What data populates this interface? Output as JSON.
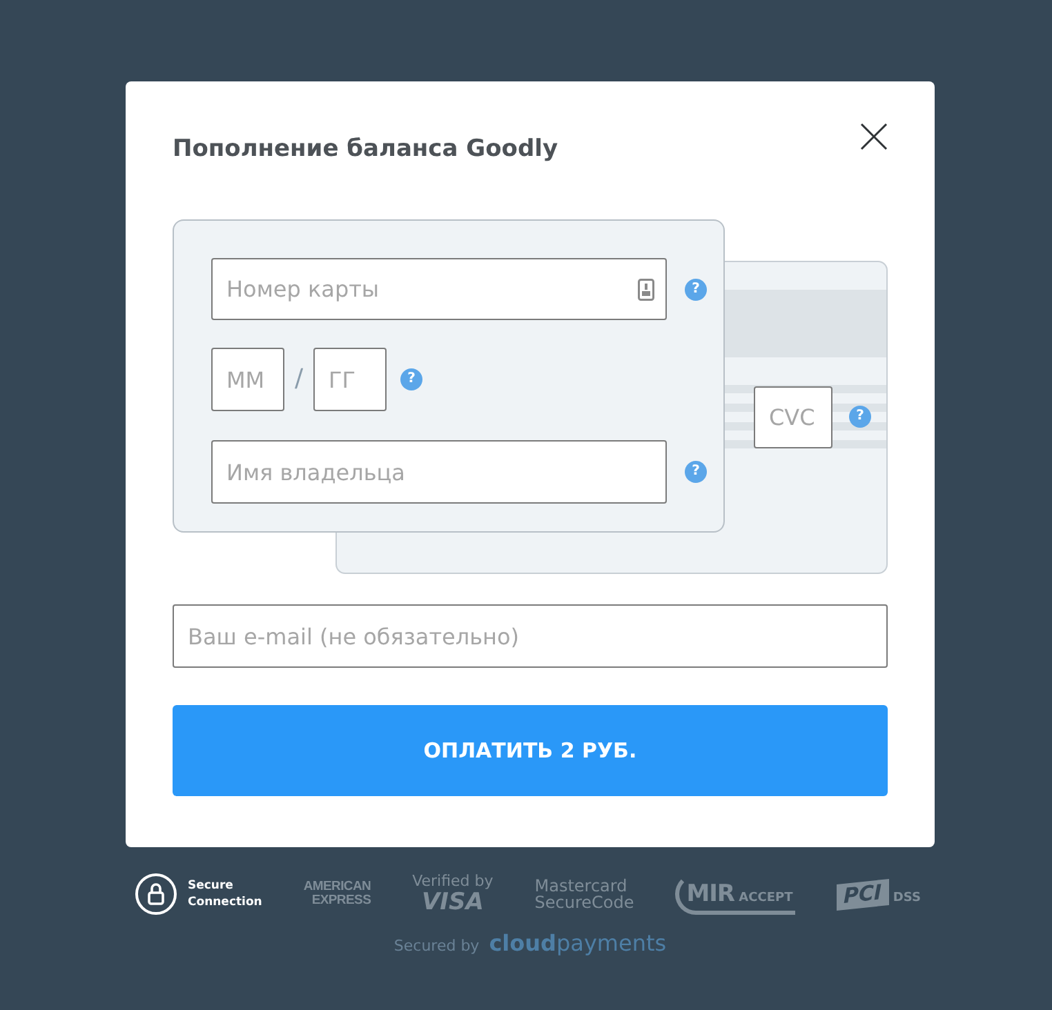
{
  "dialog": {
    "title": "Пополнение баланса Goodly"
  },
  "card_form": {
    "card_number": {
      "placeholder": "Номер карты",
      "help": "?"
    },
    "expiry": {
      "month": {
        "placeholder": "ММ"
      },
      "separator": "/",
      "year": {
        "placeholder": "ГГ"
      },
      "help": "?"
    },
    "cardholder": {
      "placeholder": "Имя владельца",
      "help": "?"
    },
    "cvc": {
      "placeholder": "CVC",
      "help": "?"
    }
  },
  "email": {
    "placeholder": "Ваш e-mail (не обязательно)"
  },
  "pay_button": {
    "label": "ОПЛАТИТЬ 2 РУБ."
  },
  "footer": {
    "secure_connection": "Secure Connection",
    "badges": [
      {
        "kind": "amex",
        "text": "AMERICAN EXPRESS"
      },
      {
        "kind": "visa",
        "text": "Verified by **VISA**"
      },
      {
        "kind": "mastercard",
        "text": "Mastercard SecureCode"
      },
      {
        "kind": "mir",
        "text": "**MIR** ACCEPT"
      },
      {
        "kind": "pci",
        "text": "**PCI** DSS"
      }
    ],
    "secured_by": "Secured by",
    "provider": "**cloud**payments"
  }
}
